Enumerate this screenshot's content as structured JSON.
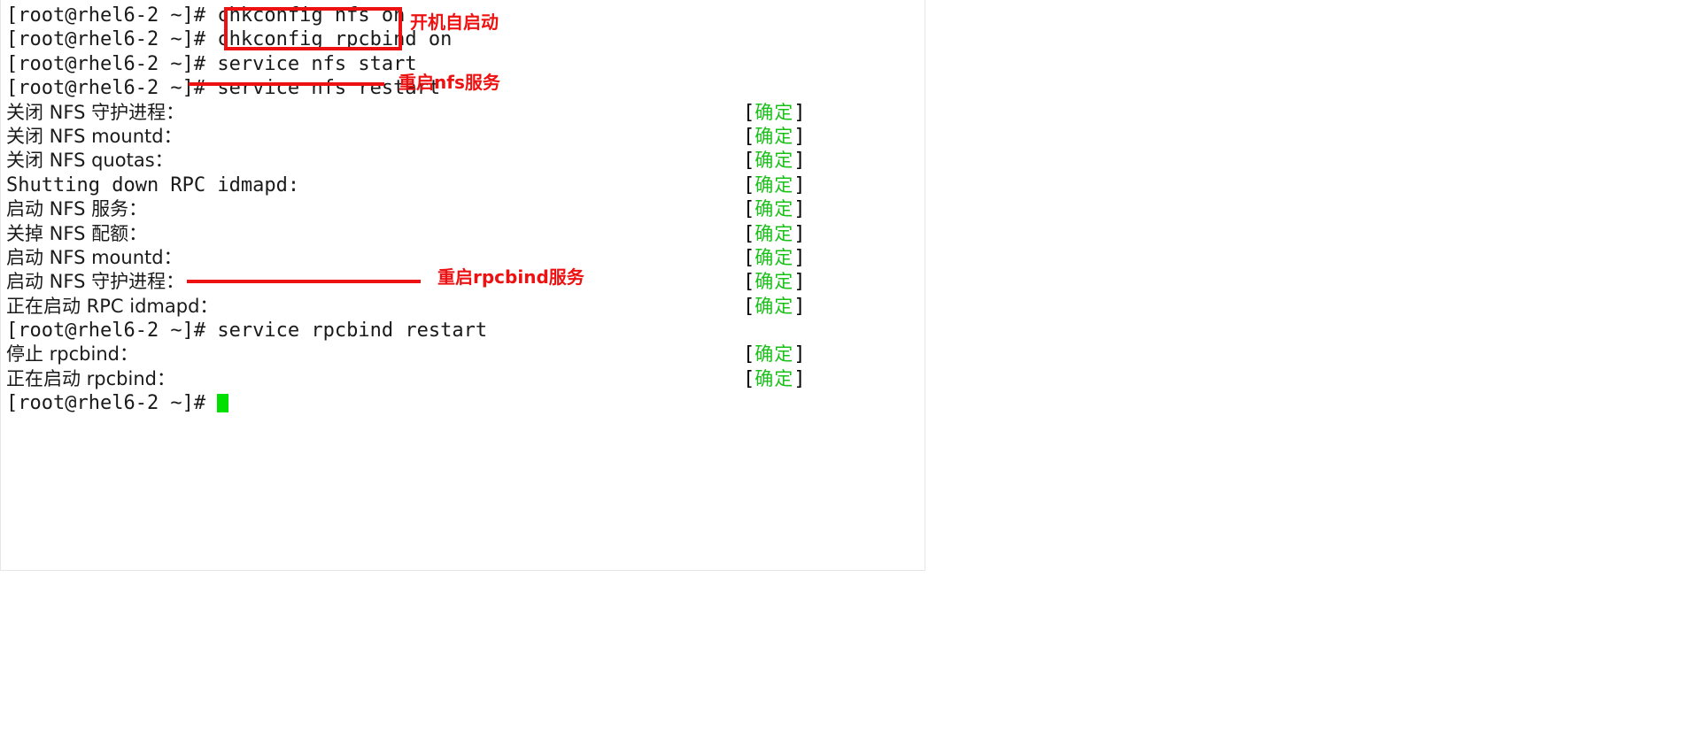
{
  "terminal": {
    "prompt": "[root@rhel6-2 ~]# ",
    "status_open": "[",
    "status_close": "]",
    "status_ok": "确定",
    "lines": [
      {
        "id": "cmd-chkconfig-nfs",
        "kind": "command",
        "prompt": "[root@rhel6-2 ~]# ",
        "text": "chkconfig nfs on",
        "status": ""
      },
      {
        "id": "cmd-chkconfig-rpcbind",
        "kind": "command",
        "prompt": "[root@rhel6-2 ~]# ",
        "text": "chkconfig rpcbind on",
        "status": ""
      },
      {
        "id": "cmd-service-nfs-start",
        "kind": "command",
        "prompt": "[root@rhel6-2 ~]# ",
        "text": "service nfs start",
        "status": ""
      },
      {
        "id": "cmd-service-nfs-restart",
        "kind": "command",
        "prompt": "[root@rhel6-2 ~]# ",
        "text": "service nfs restart",
        "status": ""
      },
      {
        "id": "out-stop-nfs-daemon",
        "kind": "output",
        "prompt": "",
        "text": "关闭 NFS 守护进程：",
        "status": "确定"
      },
      {
        "id": "out-stop-nfs-mountd",
        "kind": "output",
        "prompt": "",
        "text": "关闭 NFS mountd：",
        "status": "确定"
      },
      {
        "id": "out-stop-nfs-quotas",
        "kind": "output",
        "prompt": "",
        "text": "关闭 NFS quotas：",
        "status": "确定"
      },
      {
        "id": "out-shutdown-idmapd",
        "kind": "output",
        "prompt": "",
        "text": "Shutting down RPC idmapd:",
        "status": "确定"
      },
      {
        "id": "out-start-nfs-service",
        "kind": "output",
        "prompt": "",
        "text": "启动 NFS 服务：",
        "status": "确定"
      },
      {
        "id": "out-turnoff-nfs-quota",
        "kind": "output",
        "prompt": "",
        "text": "关掉 NFS 配额：",
        "status": "确定"
      },
      {
        "id": "out-start-nfs-mountd",
        "kind": "output",
        "prompt": "",
        "text": "启动 NFS mountd：",
        "status": "确定"
      },
      {
        "id": "out-start-nfs-daemon",
        "kind": "output",
        "prompt": "",
        "text": "启动 NFS 守护进程：",
        "status": "确定"
      },
      {
        "id": "out-starting-idmapd",
        "kind": "output",
        "prompt": "",
        "text": "正在启动 RPC idmapd：",
        "status": "确定"
      },
      {
        "id": "cmd-service-rpcbind-restart",
        "kind": "command",
        "prompt": "[root@rhel6-2 ~]# ",
        "text": "service rpcbind restart",
        "status": ""
      },
      {
        "id": "out-stop-rpcbind",
        "kind": "output",
        "prompt": "",
        "text": "停止 rpcbind：",
        "status": "确定"
      },
      {
        "id": "out-starting-rpcbind",
        "kind": "output",
        "prompt": "",
        "text": "正在启动 rpcbind：",
        "status": "确定"
      },
      {
        "id": "prompt-final",
        "kind": "prompt",
        "prompt": "[root@rhel6-2 ~]# ",
        "text": "",
        "status": ""
      }
    ]
  },
  "annotations": [
    {
      "id": "annot-autostart",
      "label": "开机自启动",
      "color": "#ee1111"
    },
    {
      "id": "annot-restart-nfs",
      "label": "重启nfs服务",
      "color": "#ee1111"
    },
    {
      "id": "annot-restart-rpcbind",
      "label": "重启rpcbind服务",
      "color": "#ee1111"
    }
  ],
  "colors": {
    "accent_red": "#ee1111",
    "status_green": "#18c018",
    "cursor_green": "#00e000",
    "text": "#1a1a1a",
    "panel_border": "#e6e6e6",
    "background": "#ffffff"
  }
}
